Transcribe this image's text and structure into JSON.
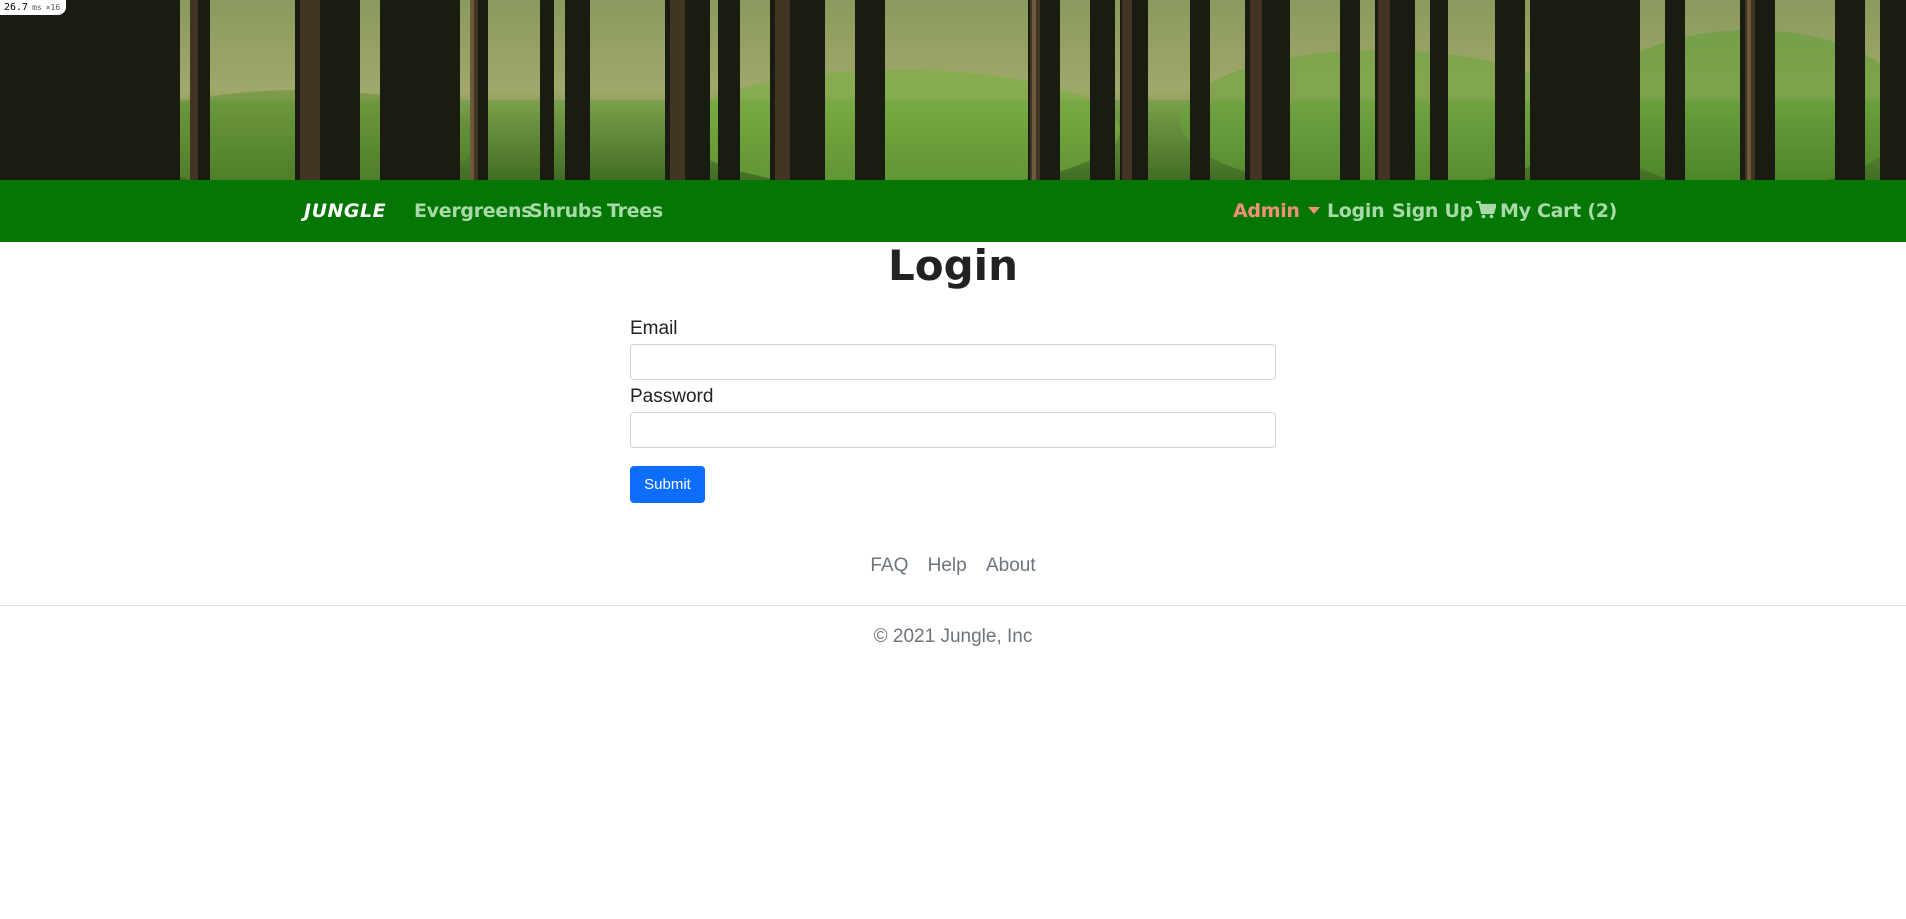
{
  "perf_overlay": {
    "value": "26.7",
    "unit": "ms",
    "multiplier": "×16"
  },
  "navbar": {
    "brand": "JUNGLE",
    "links": [
      "Evergreens",
      "Shrubs",
      "Trees"
    ],
    "admin_label": "Admin",
    "login_label": "Login",
    "signup_label": "Sign Up",
    "cart_label": "My Cart (2)",
    "background_color": "#037603",
    "admin_color": "#f0907a"
  },
  "page": {
    "title": "Login"
  },
  "form": {
    "email_label": "Email",
    "email_value": "",
    "password_label": "Password",
    "password_value": "",
    "submit_label": "Submit",
    "submit_color": "#0d6efd"
  },
  "footer": {
    "links": [
      "FAQ",
      "Help",
      "About"
    ],
    "copyright": "© 2021 Jungle, Inc"
  },
  "icons": {
    "cart": "shopping-cart-icon",
    "admin_dropdown": "caret-down-icon"
  }
}
